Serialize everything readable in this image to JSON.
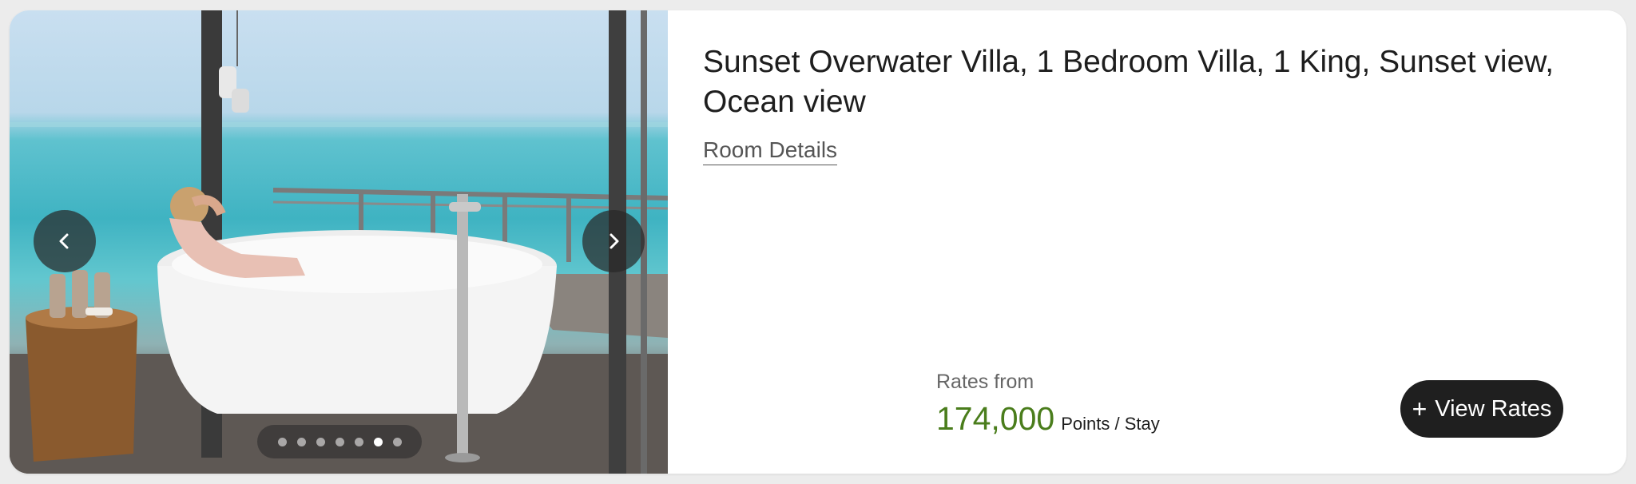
{
  "room": {
    "title": "Sunset Overwater Villa, 1 Bedroom Villa, 1 King, Sunset view, Ocean view",
    "details_link": "Room Details"
  },
  "rates": {
    "label": "Rates from",
    "price": "174,000",
    "unit": "Points / Stay",
    "button_label": "View Rates",
    "button_icon": "plus-icon"
  },
  "carousel": {
    "image_alt": "Woman relaxing in freestanding bathtub overlooking ocean",
    "prev_icon": "chevron-left-icon",
    "next_icon": "chevron-right-icon",
    "slide_count": 7,
    "active_slide": 6
  },
  "colors": {
    "price": "#4a7d1c",
    "button_bg": "#1f1f1f",
    "title": "#1e1e1e"
  }
}
